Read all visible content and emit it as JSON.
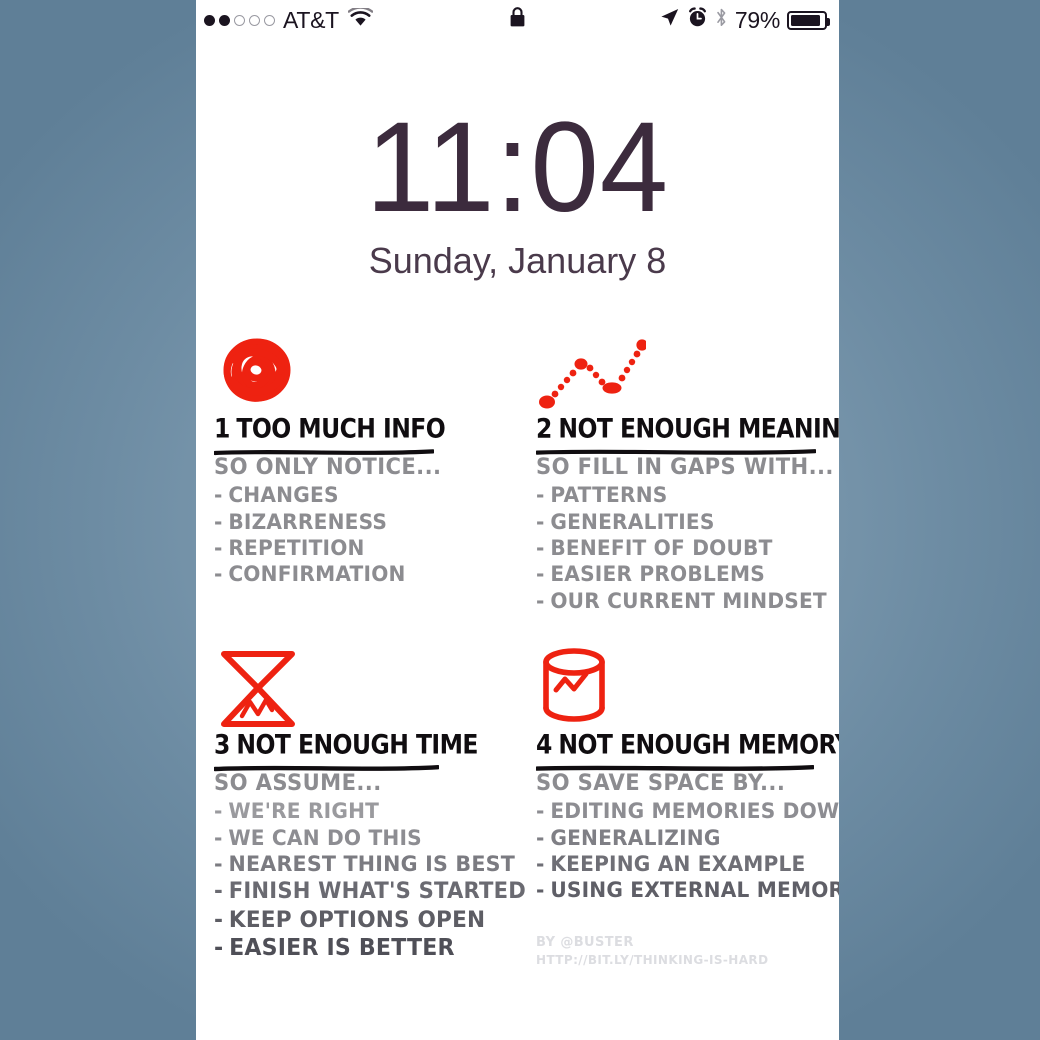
{
  "statusbar": {
    "signal_dots_filled": 2,
    "signal_dots_total": 5,
    "carrier": "AT&T",
    "wifi_icon": "wifi-icon",
    "lock_icon": "lock-icon",
    "location_icon": "location-arrow-icon",
    "alarm_icon": "alarm-clock-icon",
    "bluetooth_icon": "bluetooth-icon",
    "battery_percent": "79%",
    "battery_fill": "80%"
  },
  "lockscreen": {
    "time": "11:04",
    "date": "Sunday, January 8"
  },
  "wallpaper": {
    "accent_red": "#ee2211",
    "heading_color": "#100d10",
    "body_color": "#8c8c90",
    "quadrants": [
      {
        "id": 1,
        "icon": "red-scribble-ball-icon",
        "number": "1",
        "title": "TOO MUCH INFO",
        "subtitle": "SO ONLY NOTICE...",
        "items": [
          "CHANGES",
          "BIZARRENESS",
          "REPETITION",
          "CONFIRMATION"
        ]
      },
      {
        "id": 2,
        "icon": "red-dotted-zigzag-icon",
        "number": "2",
        "title": "NOT ENOUGH MEANING",
        "subtitle": "SO FILL IN GAPS WITH...",
        "items": [
          "PATTERNS",
          "GENERALITIES",
          "BENEFIT OF DOUBT",
          "EASIER PROBLEMS",
          "OUR CURRENT MINDSET"
        ]
      },
      {
        "id": 3,
        "icon": "red-hourglass-icon",
        "number": "3",
        "title": "NOT ENOUGH TIME",
        "subtitle": "SO ASSUME...",
        "items": [
          "WE'RE RIGHT",
          "WE CAN DO THIS",
          "NEAREST THING IS BEST",
          "FINISH WHAT'S STARTED",
          "KEEP OPTIONS OPEN",
          "EASIER IS BETTER"
        ]
      },
      {
        "id": 4,
        "icon": "red-database-cylinder-icon",
        "number": "4",
        "title": "NOT ENOUGH MEMORY",
        "subtitle": "SO SAVE SPACE BY...",
        "items": [
          "EDITING MEMORIES DOWN",
          "GENERALIZING",
          "KEEPING AN EXAMPLE",
          "USING EXTERNAL MEMORY"
        ]
      }
    ],
    "bullet": "-",
    "credit_line1": "BY @BUSTER",
    "credit_line2": "HTTP://BIT.LY/THINKING-IS-HARD"
  },
  "background": {
    "color": "#6d8ca3"
  }
}
